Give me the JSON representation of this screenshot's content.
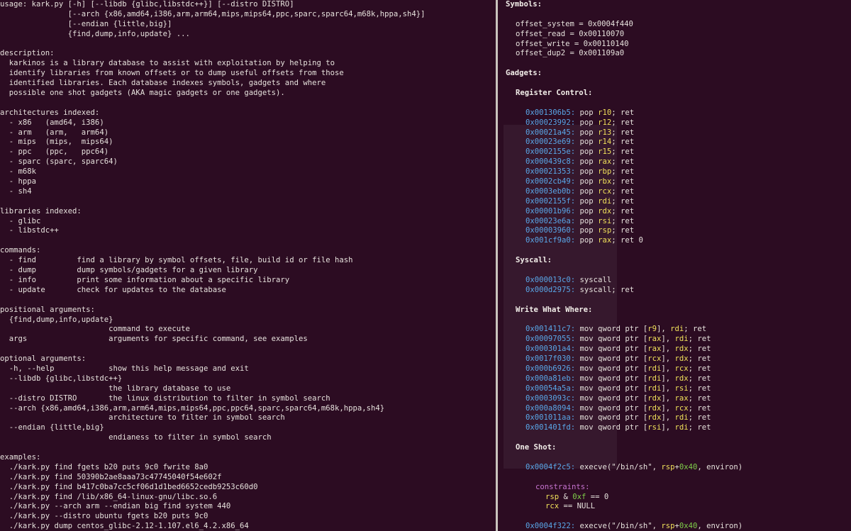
{
  "colors": {
    "background": "#2c0c22",
    "text": "#e6e1dc",
    "address": "#59a7e8",
    "register": "#f0e05a",
    "number": "#7fcf4a",
    "constraint": "#c774d0",
    "divider": "#c9c4bd"
  },
  "left_terminal": {
    "lines": [
      "usage: kark.py [-h] [--libdb {glibc,libstdc++}] [--distro DISTRO]",
      "               [--arch {x86,amd64,i386,arm,arm64,mips,mips64,ppc,sparc,sparc64,m68k,hppa,sh4}]",
      "               [--endian {little,big}]",
      "               {find,dump,info,update} ...",
      "",
      "description:",
      "  karkinos is a library database to assist with exploitation by helping to",
      "  identify libraries from known offsets or to dump useful offsets from those",
      "  identified libraries. Each database indexes symbols, gadgets and where",
      "  possible one shot gadgets (AKA magic gadgets or one gadgets).",
      "",
      "architectures indexed:",
      "  - x86   (amd64, i386)",
      "  - arm   (arm,   arm64)",
      "  - mips  (mips,  mips64)",
      "  - ppc   (ppc,   ppc64)",
      "  - sparc (sparc, sparc64)",
      "  - m68k",
      "  - hppa",
      "  - sh4",
      "",
      "libraries indexed:",
      "  - glibc",
      "  - libstdc++",
      "",
      "commands:",
      "  - find         find a library by symbol offsets, file, build id or file hash",
      "  - dump         dump symbols/gadgets for a given library",
      "  - info         print some information about a specific library",
      "  - update       check for updates to the database",
      "",
      "positional arguments:",
      "  {find,dump,info,update}",
      "                        command to execute",
      "  args                  arguments for specific command, see examples",
      "",
      "optional arguments:",
      "  -h, --help            show this help message and exit",
      "  --libdb {glibc,libstdc++}",
      "                        the library database to use",
      "  --distro DISTRO       the linux distribution to filter in symbol search",
      "  --arch {x86,amd64,i386,arm,arm64,mips,mips64,ppc,ppc64,sparc,sparc64,m68k,hppa,sh4}",
      "                        architecture to filter in symbol search",
      "  --endian {little,big}",
      "                        endianess to filter in symbol search",
      "",
      "examples:",
      "  ./kark.py find fgets b20 puts 9c0 fwrite 8a0",
      "  ./kark.py find 50390b2ae8aaa73c47745040f54e602f",
      "  ./kark.py find b417c0ba7cc5cf06d1d1bed6652cedb9253c60d0",
      "  ./kark.py find /lib/x86_64-linux-gnu/libc.so.6",
      "  ./kark.py --arch arm --endian big find system 440",
      "  ./kark.py --distro ubuntu fgets b20 puts 9c0",
      "  ./kark.py dump centos_glibc-2.12-1.107.el6_4.2.x86_64"
    ]
  },
  "right_terminal": {
    "symbols_header": "Symbols:",
    "symbols": [
      "offset_system = 0x0004f440",
      "offset_read = 0x00110070",
      "offset_write = 0x00110140",
      "offset_dup2 = 0x001109a0"
    ],
    "gadgets_header": "Gadgets:",
    "register_control_header": "Register Control:",
    "register_control": [
      {
        "addr": "0x001306b5:",
        "pre": " pop ",
        "reg": "r10",
        "post": "; ret"
      },
      {
        "addr": "0x00023992:",
        "pre": " pop ",
        "reg": "r12",
        "post": "; ret"
      },
      {
        "addr": "0x00021a45:",
        "pre": " pop ",
        "reg": "r13",
        "post": "; ret"
      },
      {
        "addr": "0x00023e69:",
        "pre": " pop ",
        "reg": "r14",
        "post": "; ret"
      },
      {
        "addr": "0x0002155e:",
        "pre": " pop ",
        "reg": "r15",
        "post": "; ret"
      },
      {
        "addr": "0x000439c8:",
        "pre": " pop ",
        "reg": "rax",
        "post": "; ret"
      },
      {
        "addr": "0x00021353:",
        "pre": " pop ",
        "reg": "rbp",
        "post": "; ret"
      },
      {
        "addr": "0x0002cb49:",
        "pre": " pop ",
        "reg": "rbx",
        "post": "; ret"
      },
      {
        "addr": "0x0003eb0b:",
        "pre": " pop ",
        "reg": "rcx",
        "post": "; ret"
      },
      {
        "addr": "0x0002155f:",
        "pre": " pop ",
        "reg": "rdi",
        "post": "; ret"
      },
      {
        "addr": "0x00001b96:",
        "pre": " pop ",
        "reg": "rdx",
        "post": "; ret"
      },
      {
        "addr": "0x00023e6a:",
        "pre": " pop ",
        "reg": "rsi",
        "post": "; ret"
      },
      {
        "addr": "0x00003960:",
        "pre": " pop ",
        "reg": "rsp",
        "post": "; ret"
      },
      {
        "addr": "0x001cf9a0:",
        "pre": " pop ",
        "reg": "rax",
        "post": "; ret 0"
      }
    ],
    "syscall_header": "Syscall:",
    "syscall": [
      {
        "addr": "0x000013c0:",
        "text": " syscall"
      },
      {
        "addr": "0x000d2975:",
        "text": " syscall; ret"
      }
    ],
    "www_header": "Write What Where:",
    "write_what_where": [
      {
        "addr": "0x001411c7:",
        "a": " mov qword ptr [",
        "r1": "r9",
        "b": "], ",
        "r2": "rdi",
        "c": "; ret"
      },
      {
        "addr": "0x00097055:",
        "a": " mov qword ptr [",
        "r1": "rax",
        "b": "], ",
        "r2": "rdi",
        "c": "; ret"
      },
      {
        "addr": "0x000301a4:",
        "a": " mov qword ptr [",
        "r1": "rax",
        "b": "], ",
        "r2": "rdx",
        "c": "; ret"
      },
      {
        "addr": "0x0017f030:",
        "a": " mov qword ptr [",
        "r1": "rcx",
        "b": "], ",
        "r2": "rdx",
        "c": "; ret"
      },
      {
        "addr": "0x000b6926:",
        "a": " mov qword ptr [",
        "r1": "rdi",
        "b": "], ",
        "r2": "rcx",
        "c": "; ret"
      },
      {
        "addr": "0x000a81eb:",
        "a": " mov qword ptr [",
        "r1": "rdi",
        "b": "], ",
        "r2": "rdx",
        "c": "; ret"
      },
      {
        "addr": "0x00054a5a:",
        "a": " mov qword ptr [",
        "r1": "rdi",
        "b": "], ",
        "r2": "rsi",
        "c": "; ret"
      },
      {
        "addr": "0x0003093c:",
        "a": " mov qword ptr [",
        "r1": "rdx",
        "b": "], ",
        "r2": "rax",
        "c": "; ret"
      },
      {
        "addr": "0x000a8094:",
        "a": " mov qword ptr [",
        "r1": "rdx",
        "b": "], ",
        "r2": "rcx",
        "c": "; ret"
      },
      {
        "addr": "0x001011aa:",
        "a": " mov qword ptr [",
        "r1": "rdx",
        "b": "], ",
        "r2": "rdi",
        "c": "; ret"
      },
      {
        "addr": "0x001401fd:",
        "a": " mov qword ptr [",
        "r1": "rsi",
        "b": "], ",
        "r2": "rdi",
        "c": "; ret"
      }
    ],
    "one_shot_header": "One Shot:",
    "one_shot_1": {
      "addr": "0x0004f2c5:",
      "a": " execve(\"/bin/sh\", ",
      "reg": "rsp",
      "plus": "+",
      "num": "0x40",
      "b": ", environ)"
    },
    "constraints_label": "constraints:",
    "constraint_1": {
      "reg": "rsp",
      "op": " & ",
      "num": "0xf",
      "rest": " == 0"
    },
    "constraint_2": {
      "reg": "rcx",
      "rest": " == NULL"
    },
    "one_shot_2": {
      "addr": "0x0004f322:",
      "a": " execve(\"/bin/sh\", ",
      "reg": "rsp",
      "plus": "+",
      "num": "0x40",
      "b": ", environ)"
    }
  }
}
